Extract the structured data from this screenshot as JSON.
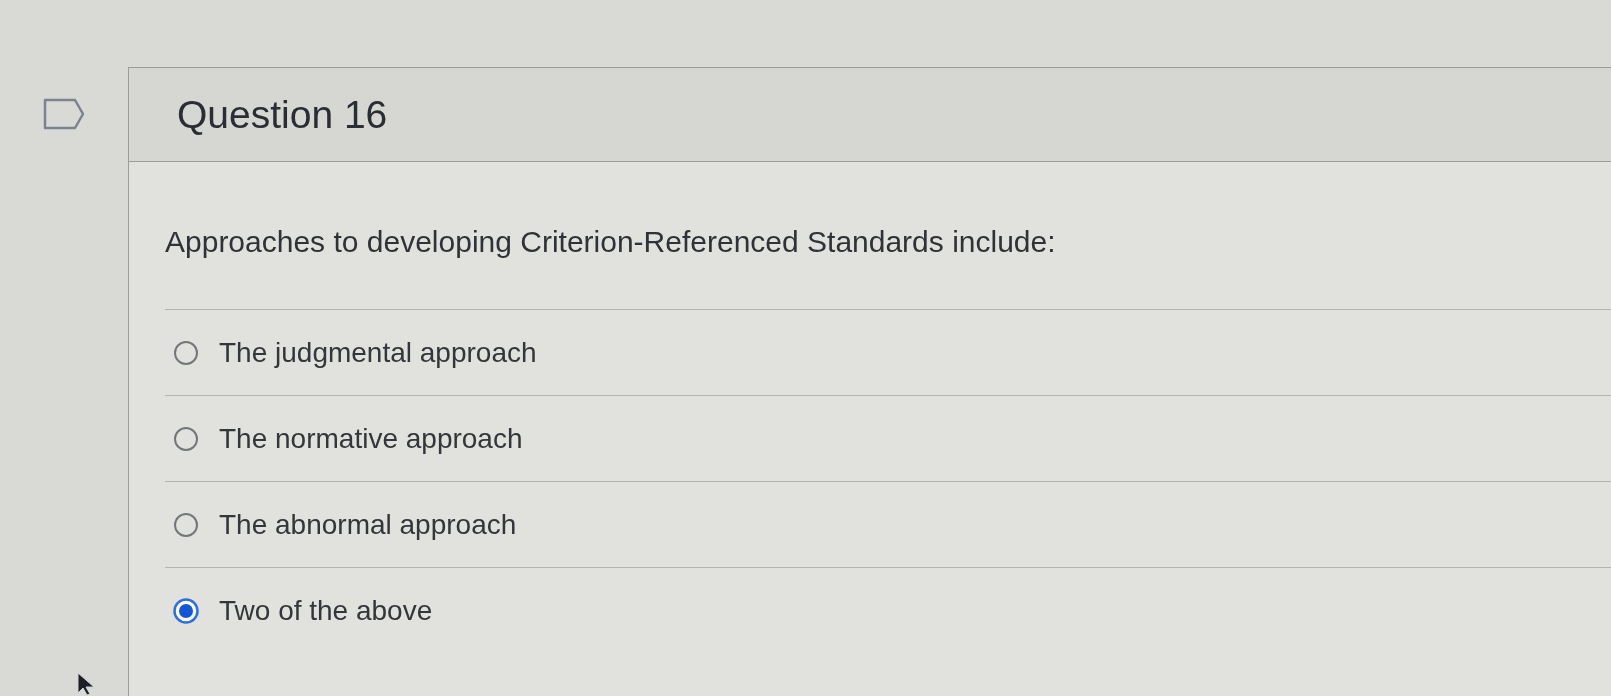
{
  "flag": {
    "flagged": false
  },
  "question": {
    "title": "Question 16",
    "prompt": "Approaches to developing Criterion-Referenced Standards include:",
    "options": [
      {
        "label": "The judgmental approach",
        "selected": false
      },
      {
        "label": "The normative approach",
        "selected": false
      },
      {
        "label": "The abnormal approach",
        "selected": false
      },
      {
        "label": "Two of the above",
        "selected": true
      }
    ]
  }
}
